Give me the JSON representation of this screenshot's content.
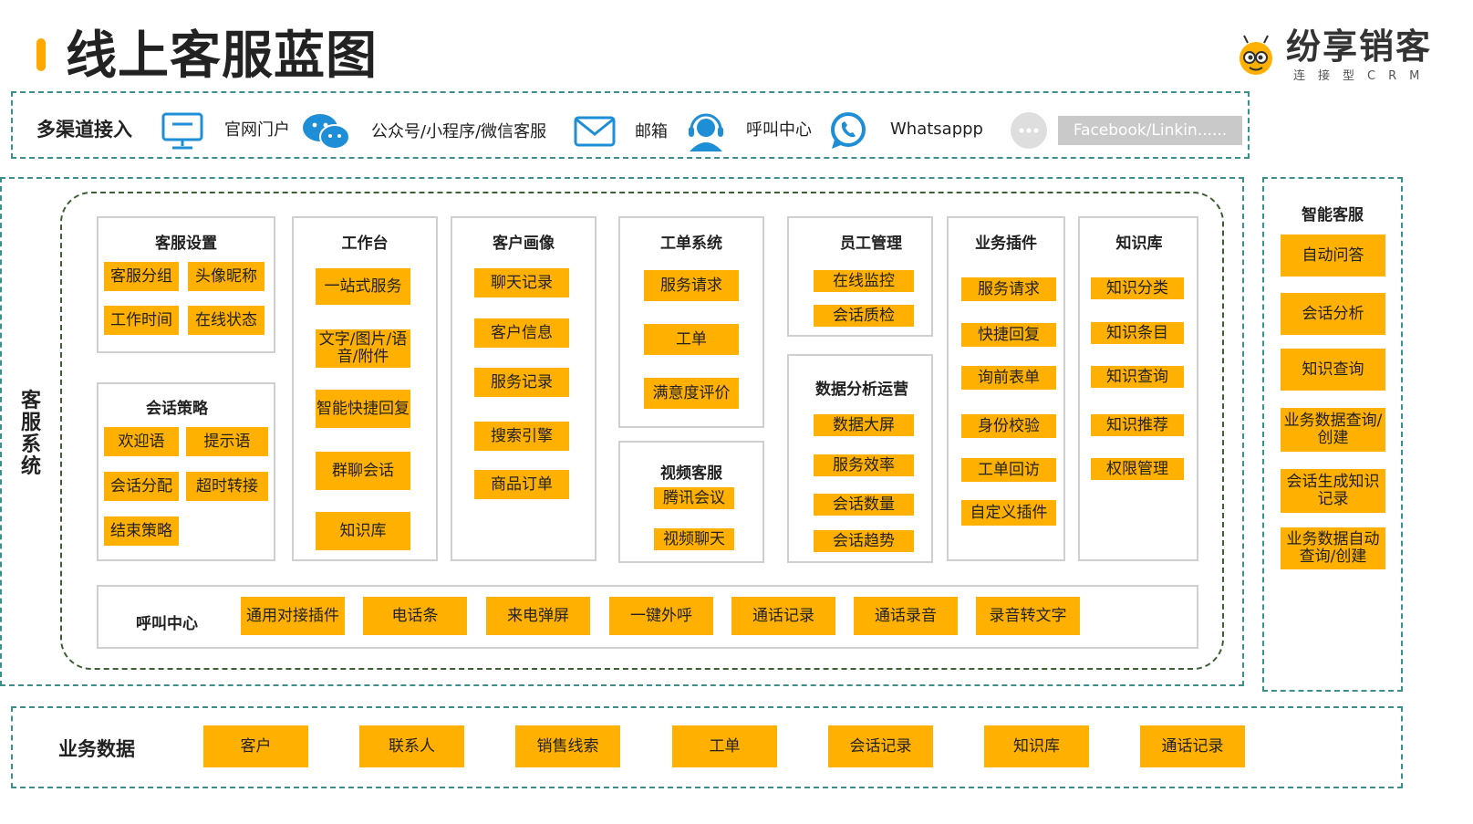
{
  "page": {
    "title": "线上客服蓝图",
    "brand": {
      "name": "纷享销客",
      "subtitle": "连接型CRM"
    }
  },
  "colors": {
    "accent": "#FFB000",
    "title_bar": "#FFA800",
    "teal_dash": "#3d8f8a",
    "green_dash": "#3f5e34",
    "icon_blue": "#1e8fd6"
  },
  "channels": {
    "label": "多渠道接入",
    "items": [
      {
        "icon": "monitor-icon",
        "label": "官网门户"
      },
      {
        "icon": "wechat-icon",
        "label": "公众号/小程序/微信客服"
      },
      {
        "icon": "mail-icon",
        "label": "邮箱"
      },
      {
        "icon": "headset-icon",
        "label": "呼叫中心"
      },
      {
        "icon": "whatsapp-icon",
        "label": "Whatsappp"
      },
      {
        "icon": "more-icon",
        "label": "Facebook/Linkin......"
      }
    ]
  },
  "service_system": {
    "label": "客服系统",
    "modules": {
      "settings": {
        "title": "客服设置",
        "items": [
          "客服分组",
          "头像昵称",
          "工作时间",
          "在线状态"
        ]
      },
      "strategy": {
        "title": "会话策略",
        "items": [
          "欢迎语",
          "提示语",
          "会话分配",
          "超时转接",
          "结束策略"
        ]
      },
      "workbench": {
        "title": "工作台",
        "items": [
          "一站式服务",
          "文字/图片/语音/附件",
          "智能快捷回复",
          "群聊会话",
          "知识库"
        ]
      },
      "portrait": {
        "title": "客户画像",
        "items": [
          "聊天记录",
          "客户信息",
          "服务记录",
          "搜索引擎",
          "商品订单"
        ]
      },
      "ticket": {
        "title": "工单系统",
        "items": [
          "服务请求",
          "工单",
          "满意度评价"
        ]
      },
      "video": {
        "title": "视频客服",
        "items": [
          "腾讯会议",
          "视频聊天"
        ]
      },
      "staff": {
        "title": "员工管理",
        "items": [
          "在线监控",
          "会话质检"
        ]
      },
      "analytics": {
        "title": "数据分析运营",
        "items": [
          "数据大屏",
          "服务效率",
          "会话数量",
          "会话趋势"
        ]
      },
      "plugins": {
        "title": "业务插件",
        "items": [
          "服务请求",
          "快捷回复",
          "询前表单",
          "身份校验",
          "工单回访",
          "自定义插件"
        ]
      },
      "knowledge": {
        "title": "知识库",
        "items": [
          "知识分类",
          "知识条目",
          "知识查询",
          "知识推荐",
          "权限管理"
        ]
      }
    },
    "call_center": {
      "title": "呼叫中心",
      "items": [
        "通用对接插件",
        "电话条",
        "来电弹屏",
        "一键外呼",
        "通话记录",
        "通话录音",
        "录音转文字"
      ]
    }
  },
  "smart_service": {
    "title": "智能客服",
    "items": [
      "自动问答",
      "会话分析",
      "知识查询",
      "业务数据查询/创建",
      "会话生成知识记录",
      "业务数据自动查询/创建"
    ]
  },
  "business_data": {
    "label": "业务数据",
    "items": [
      "客户",
      "联系人",
      "销售线索",
      "工单",
      "会话记录",
      "知识库",
      "通话记录"
    ]
  }
}
